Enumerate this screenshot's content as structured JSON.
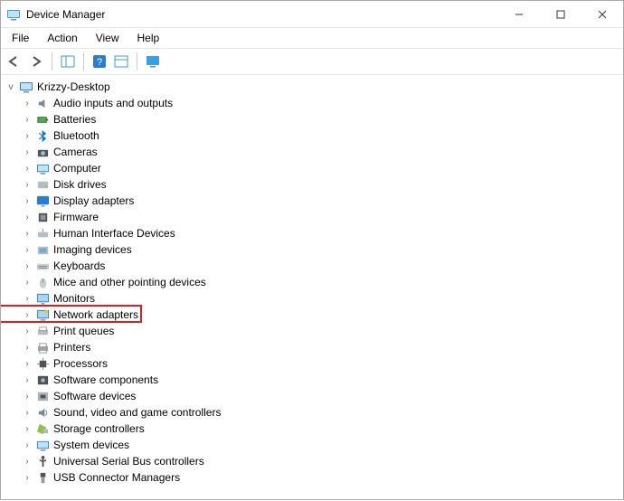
{
  "window": {
    "title": "Device Manager"
  },
  "menu": {
    "file": "File",
    "action": "Action",
    "view": "View",
    "help": "Help"
  },
  "toolbar": {
    "back": "Back",
    "forward": "Forward",
    "show_hide_tree": "Show/Hide Console Tree",
    "help": "Help",
    "properties": "Properties",
    "monitor": "Devices"
  },
  "root": {
    "label": "Krizzy-Desktop",
    "expanded": true
  },
  "categories": [
    {
      "label": "Audio inputs and outputs",
      "icon": "audio"
    },
    {
      "label": "Batteries",
      "icon": "battery"
    },
    {
      "label": "Bluetooth",
      "icon": "bluetooth"
    },
    {
      "label": "Cameras",
      "icon": "camera"
    },
    {
      "label": "Computer",
      "icon": "computer"
    },
    {
      "label": "Disk drives",
      "icon": "disk"
    },
    {
      "label": "Display adapters",
      "icon": "display"
    },
    {
      "label": "Firmware",
      "icon": "firmware"
    },
    {
      "label": "Human Interface Devices",
      "icon": "hid"
    },
    {
      "label": "Imaging devices",
      "icon": "imaging"
    },
    {
      "label": "Keyboards",
      "icon": "keyboard"
    },
    {
      "label": "Mice and other pointing devices",
      "icon": "mouse"
    },
    {
      "label": "Monitors",
      "icon": "monitor"
    },
    {
      "label": "Network adapters",
      "icon": "network",
      "highlighted": true
    },
    {
      "label": "Print queues",
      "icon": "printqueue"
    },
    {
      "label": "Printers",
      "icon": "printer"
    },
    {
      "label": "Processors",
      "icon": "cpu"
    },
    {
      "label": "Software components",
      "icon": "swcomp"
    },
    {
      "label": "Software devices",
      "icon": "swdev"
    },
    {
      "label": "Sound, video and game controllers",
      "icon": "sound"
    },
    {
      "label": "Storage controllers",
      "icon": "storage"
    },
    {
      "label": "System devices",
      "icon": "system"
    },
    {
      "label": "Universal Serial Bus controllers",
      "icon": "usb"
    },
    {
      "label": "USB Connector Managers",
      "icon": "usbconn"
    }
  ],
  "highlight_color": "#e21c1c"
}
